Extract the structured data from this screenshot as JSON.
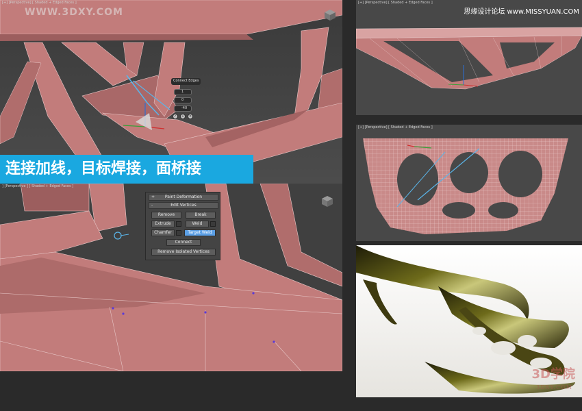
{
  "watermark_top": "WWW.3DXY.COM",
  "watermark_right": "思缘设计论坛 www.MISSYUAN.COM",
  "banner_text": "连接加线，目标焊接，面桥接",
  "viewports": {
    "top_left_label": "[+] [Perspective] [ Shaded + Edged Faces ]",
    "bottom_left_label": "] [Perspective ] [ Shaded + Edged Faces ]",
    "top_right_label": "[+] [Perspective] [ Shaded + Edged Faces ]",
    "mid_right_label": "[+] [Perspective] [ Shaded + Edged Faces ]"
  },
  "connect_caddy": {
    "title": "Connect Edges",
    "segments": "1",
    "pinch": "0",
    "slide": "-40",
    "ok_icon": "check-icon",
    "apply_icon": "plus-icon",
    "cancel_icon": "close-icon"
  },
  "edit_panel": {
    "paint_deformation": "Paint Deformation",
    "edit_vertices": "Edit Vertices",
    "remove": "Remove",
    "break": "Break",
    "extrude": "Extrude",
    "weld": "Weld",
    "chamfer": "Chamfer",
    "target_weld": "Target Weld",
    "connect": "Connect",
    "remove_isolated": "Remove Isolated Vertices",
    "plus_sign": "+",
    "minus_sign": "-"
  },
  "render_logo": "3D学院",
  "render_url": "3DXY.COM",
  "colors": {
    "mesh_pink": "#c9807f",
    "mesh_shadow": "#8f5252",
    "banner_blue": "#1aa8e0",
    "active_button": "#5b9fe6",
    "edge_select": "#5ab4e8"
  }
}
